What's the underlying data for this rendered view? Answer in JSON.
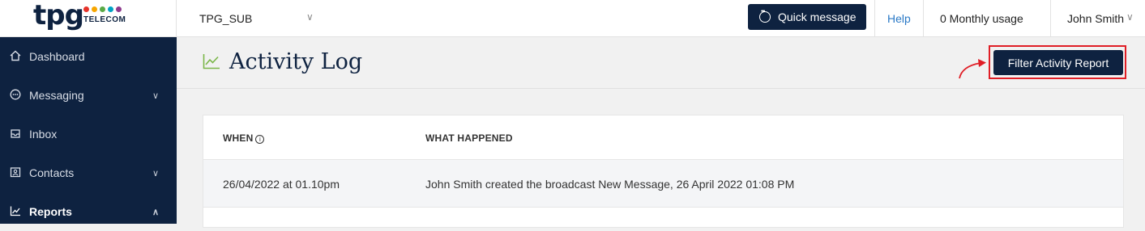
{
  "brand": {
    "logo_text": "tpg",
    "logo_sub": "TELECOM",
    "dot_colors": [
      "#e6332a",
      "#f7a600",
      "#5aaa46",
      "#00a3c4",
      "#8e3a8d"
    ]
  },
  "topbar": {
    "account": "TPG_SUB",
    "quick_message": "Quick message",
    "help": "Help",
    "usage": "0 Monthly usage",
    "user": "John Smith"
  },
  "sidebar": {
    "items": [
      {
        "label": "Dashboard",
        "icon": "home-icon"
      },
      {
        "label": "Messaging",
        "icon": "chat-icon"
      },
      {
        "label": "Inbox",
        "icon": "inbox-icon"
      },
      {
        "label": "Contacts",
        "icon": "contacts-icon"
      },
      {
        "label": "Reports",
        "icon": "chart-icon"
      }
    ]
  },
  "header": {
    "title": "Activity Log",
    "filter_button": "Filter Activity Report"
  },
  "table": {
    "columns": [
      "WHEN",
      "WHAT HAPPENED"
    ],
    "rows": [
      {
        "when": "26/04/2022 at 01.10pm",
        "what": "John Smith created the broadcast New Message, 26 April 2022 01:08 PM"
      }
    ]
  },
  "colors": {
    "navy": "#0e2240",
    "accent_green": "#7ab648",
    "highlight_red": "#e01e26",
    "link_blue": "#2a79c6"
  }
}
